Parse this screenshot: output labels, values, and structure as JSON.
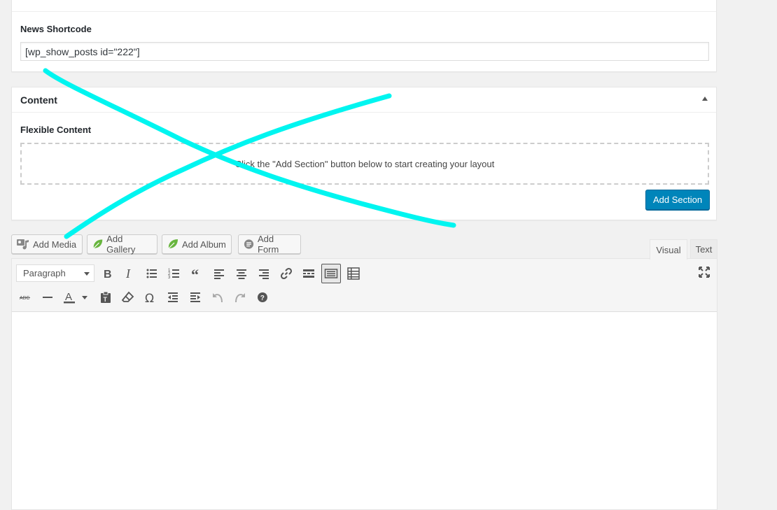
{
  "shortcode": {
    "label": "News Shortcode",
    "value": "[wp_show_posts id=\"222\"]"
  },
  "content_box": {
    "title": "Content",
    "flex_label": "Flexible Content",
    "empty_message": "Click the \"Add Section\" button below to start creating your layout",
    "add_section_label": "Add Section"
  },
  "media_buttons": {
    "add_media": "Add Media",
    "add_gallery": "Add Gallery",
    "add_album": "Add Album",
    "add_form": "Add Form"
  },
  "editor_tabs": {
    "visual": "Visual",
    "text": "Text"
  },
  "toolbar": {
    "format_value": "Paragraph",
    "row1_icons": [
      "bold-icon",
      "italic-icon",
      "bullet-list-icon",
      "numbered-list-icon",
      "blockquote-icon",
      "align-left-icon",
      "align-center-icon",
      "align-right-icon",
      "link-icon",
      "read-more-icon",
      "keyboard-icon",
      "toolbar-toggle-icon",
      "fullscreen-icon"
    ],
    "row2_icons": [
      "strikethrough-icon",
      "horizontal-line-icon",
      "text-color-icon",
      "paste-text-icon",
      "clear-formatting-icon",
      "special-character-icon",
      "outdent-icon",
      "indent-icon",
      "undo-icon",
      "redo-icon",
      "help-icon"
    ]
  },
  "colors": {
    "primary_button": "#0085ba",
    "annotation_stroke": "#00f5f0",
    "leaf_green": "#68b53f"
  }
}
